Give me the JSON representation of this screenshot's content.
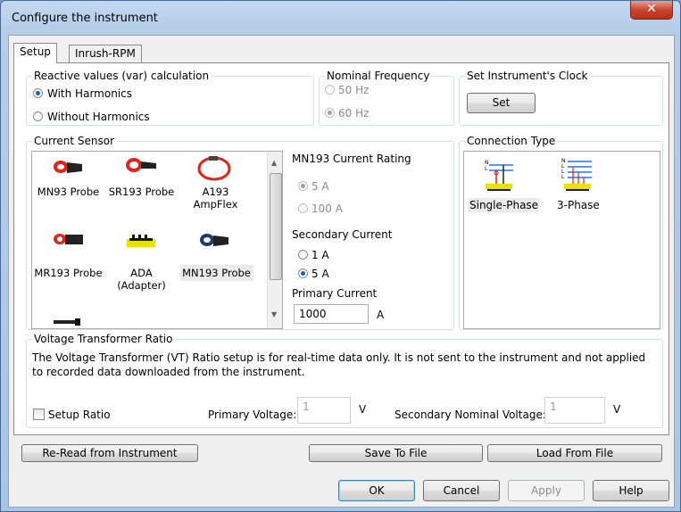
{
  "window": {
    "title": "Configure the instrument",
    "close_glyph": "✕"
  },
  "tabs": [
    {
      "label": "Setup"
    },
    {
      "label": "Inrush-RPM"
    }
  ],
  "reactive": {
    "label": "Reactive values (var) calculation",
    "with": "With Harmonics",
    "without": "Without Harmonics",
    "selected": "with"
  },
  "freq": {
    "label": "Nominal Frequency",
    "hz50": "50 Hz",
    "hz60": "60 Hz",
    "selected": "60 Hz"
  },
  "clock": {
    "label": "Set Instrument's Clock",
    "set_button": "Set"
  },
  "sensor": {
    "label": "Current Sensor",
    "items": [
      {
        "label": "MN93 Probe",
        "icon": "clamp-probe-icon"
      },
      {
        "label": "SR193 Probe",
        "icon": "clamp-probe-icon"
      },
      {
        "label": "A193\nAmpFlex",
        "icon": "flex-loop-icon"
      },
      {
        "label": "MR193 Probe",
        "icon": "clamp-probe-icon"
      },
      {
        "label": "ADA\n(Adapter)",
        "icon": "adapter-icon"
      },
      {
        "label": "MN193 Probe",
        "icon": "clamp-probe-icon",
        "selected": true
      }
    ],
    "rating_label": "MN193 Current Rating",
    "rating_5a": "5 A",
    "rating_100a": "100 A",
    "secondary_label": "Secondary Current",
    "sec_1a": "1 A",
    "sec_5a": "5 A",
    "secondary_selected": "5 A",
    "primary_label": "Primary Current",
    "primary_value": "1000",
    "primary_unit": "A"
  },
  "connection": {
    "label": "Connection Type",
    "single": "Single-Phase",
    "three": "3-Phase",
    "selected": "Single-Phase"
  },
  "vt": {
    "label": "Voltage Transformer Ratio",
    "description": "The Voltage Transformer (VT) Ratio setup is for real-time data only. It is not sent to the instrument and not applied to recorded data downloaded from the instrument.",
    "setup_ratio": "Setup Ratio",
    "primary_label": "Primary Voltage:",
    "primary_value": "1",
    "primary_unit": "V",
    "secondary_label": "Secondary Nominal Voltage:",
    "secondary_value": "1",
    "secondary_unit": "V"
  },
  "actions": {
    "reread": "Re-Read from Instrument",
    "save": "Save To File",
    "load": "Load From File"
  },
  "dialog_buttons": {
    "ok": "OK",
    "cancel": "Cancel",
    "apply": "Apply",
    "help": "Help"
  }
}
